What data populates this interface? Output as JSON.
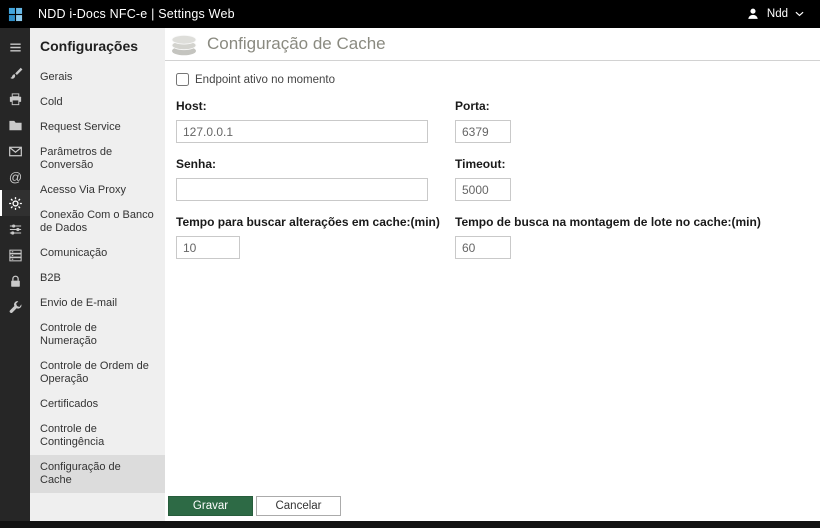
{
  "topbar": {
    "title": "NDD i-Docs NFC-e | Settings Web",
    "user": "Ndd"
  },
  "iconbar": {
    "items": [
      "menu",
      "brush",
      "printer",
      "folder",
      "mail",
      "at-sign",
      "gear",
      "sliders",
      "server-stack",
      "lock",
      "wrench"
    ],
    "active": "gear"
  },
  "sidebar": {
    "title": "Configurações",
    "items": [
      {
        "label": "Gerais"
      },
      {
        "label": "Cold"
      },
      {
        "label": "Request Service"
      },
      {
        "label": "Parâmetros de Conversão"
      },
      {
        "label": "Acesso Via Proxy"
      },
      {
        "label": "Conexão Com o Banco de Dados"
      },
      {
        "label": "Comunicação"
      },
      {
        "label": "B2B"
      },
      {
        "label": "Envio de E-mail"
      },
      {
        "label": "Controle de Numeração"
      },
      {
        "label": "Controle de Ordem de Operação"
      },
      {
        "label": "Certificados"
      },
      {
        "label": "Controle de Contingência"
      },
      {
        "label": "Configuração de Cache",
        "selected": true
      }
    ]
  },
  "main": {
    "title": "Configuração de Cache",
    "checkbox": {
      "label": "Endpoint ativo no momento",
      "checked": false
    },
    "fields": {
      "host": {
        "label": "Host:",
        "value": "127.0.0.1"
      },
      "porta": {
        "label": "Porta:",
        "value": "6379"
      },
      "senha": {
        "label": "Senha:",
        "value": ""
      },
      "timeout": {
        "label": "Timeout:",
        "value": "5000"
      },
      "tempo_busca_alteracoes": {
        "label": "Tempo para buscar alterações em cache:(min)",
        "value": "10"
      },
      "tempo_busca_lote": {
        "label": "Tempo de busca na montagem de lote no cache:(min)",
        "value": "60"
      }
    },
    "buttons": {
      "save": "Gravar",
      "cancel": "Cancelar"
    }
  },
  "colors": {
    "topbar_bg": "#000000",
    "iconbar_bg": "#262626",
    "sidebar_bg": "#efefef",
    "sidebar_selected_bg": "#dcdcdc",
    "save_button_bg": "#2d6a45",
    "page_title_color": "#8a8a80"
  }
}
